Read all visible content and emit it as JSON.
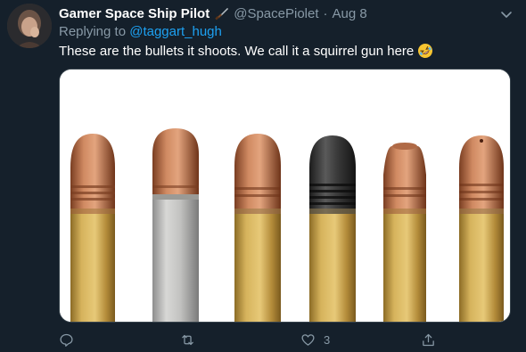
{
  "tweet": {
    "display_name": "Gamer Space Ship Pilot",
    "handle": "@SpacePiolet",
    "separator": "·",
    "date": "Aug 8",
    "replying_prefix": "Replying to",
    "replying_to": "@taggart_hugh",
    "text": "These are the bullets it shoots. We call it a squirrel gun here",
    "emoji": "rolling-on-floor-laughing-icon",
    "name_emoji": "dagger-icon"
  },
  "media": {
    "description_icon": "bullets-photo"
  },
  "actions": {
    "reply_count": "",
    "retweet_count": "",
    "like_count": "3",
    "share_count": ""
  },
  "colors": {
    "background": "#15202b",
    "secondary_text": "#8899a6",
    "link": "#1da1f2",
    "primary_text": "#ffffff"
  }
}
